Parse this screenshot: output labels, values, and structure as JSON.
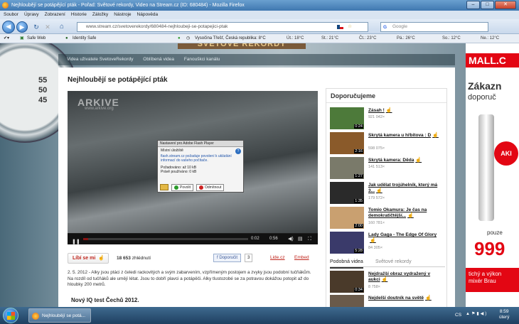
{
  "window": {
    "title": "Nejhloubějí se potápějící pták - Pořad: Světové rekordy, Video na Stream.cz (ID: 680484) - Mozilla Firefox"
  },
  "menu": [
    "Soubor",
    "Úpravy",
    "Zobrazení",
    "Historie",
    "Záložky",
    "Nástroje",
    "Nápověda"
  ],
  "nav": {
    "url": "www.stream.cz/svetoverekordy/680484-nejhloubeji-se-potapejici-ptak",
    "search_placeholder": "Google"
  },
  "toolbar": {
    "safeweb": "Safe Web",
    "identity": "Identity Safe",
    "location": "Vysočina Třešť, Česká republika: 8°C",
    "weather": [
      "Út.: 18°C",
      "St.: 21°C",
      "Čt.: 23°C",
      "Pá.: 26°C",
      "So.: 12°C",
      "Ne.: 12°C"
    ]
  },
  "site": {
    "nav": [
      "Videa uživatele SvetoveRekordy",
      "Oblíbená videa",
      "Fanouškci kanálu"
    ],
    "page_title": "Nejhloubějí se potápějící pták",
    "logo_text": "SVĚTOVÉ REKORDY"
  },
  "player": {
    "watermark": "ARKIVE",
    "watermark_sub": "www.arkive.org",
    "time_current": "0:02",
    "time_total": "0:56",
    "progress": 0.03
  },
  "flash_dialog": {
    "title": "Nastavení pro Adobe Flash Player",
    "section": "Místní úložiště",
    "text1": "flash.stream.cz požaduje povolení k ukládání informací do vašeho počítače.",
    "requested": "Požadováno: až 10 kB",
    "used": "Právě používáno: 0 kB",
    "allow": "Povolit",
    "deny": "Odmítnout",
    "help": "?"
  },
  "actions": {
    "like": "Líbí se mi",
    "views_count": "18 653",
    "views_label": "zhlédnutí",
    "fb": "Doporučit",
    "fb_count": "3",
    "lidecz": "Lide.cz",
    "embed": "Embed"
  },
  "description": "2. 5. 2012 - Alky jsou ptáci z čeledi rackovitých a svým zabarvením, vzpřímeným postojem a zvyky jsou podobní tučňákům. Na rozdíl od tučňáků ale umějí létat. Jsou to dobří plavci a potápěči. Alky tlustozobé se za potravou dokážou potopit až do hloubky 200 metrů.",
  "next_section": "Nový IQ test Čechů 2012.",
  "sidebar": {
    "header": "Doporučujeme",
    "items": [
      {
        "title": "Zásah !",
        "views": "921 042×",
        "dur": "0:24",
        "color": "#4d7a3a"
      },
      {
        "title": "Skrytá kamera u hřbitova : D",
        "views": "598 075×",
        "dur": "2:16",
        "color": "#8a5a2a"
      },
      {
        "title": "Skrytá kamera: Děda",
        "views": "141 513×",
        "dur": "1:27",
        "color": "#7a7a6a"
      },
      {
        "title": "Jak udělat trojúhelník, který má 3...",
        "views": "179 572×",
        "dur": "1:35",
        "color": "#2a2a2a"
      },
      {
        "title": "Tomio Okamura: Je čas na demokratičtější...",
        "views": "160 781×",
        "dur": "2:00",
        "color": "#c9a070"
      },
      {
        "title": "Lady Gaga - The Edge Of Glory",
        "views": "84 305×",
        "dur": "5:28",
        "color": "#3a3a6a"
      }
    ],
    "tab1": "Podobná videa",
    "tab2": "Světové rekordy",
    "similar": [
      {
        "title": "Nejdražší obraz vydražený v aukci",
        "views": "8 758×",
        "dur": "0:34",
        "color": "#4a3a2a"
      },
      {
        "title": "Nejdelší doutník na světě",
        "views": "",
        "dur": "",
        "color": "#6a5a4a"
      }
    ]
  },
  "ad": {
    "logo": "MALL.C",
    "line1": "Zákazn",
    "line2": "doporuč",
    "badge": "AKI",
    "line3": "pouze",
    "price": "999",
    "line4": "tichý a výkon",
    "line5": "mixér Brau"
  },
  "taskbar": {
    "task": "Nejhloubějí se potá...",
    "lang": "CS",
    "time": "8:59",
    "day": "úterý"
  },
  "colors": {
    "accent": "#c0261d",
    "mall": "#e30613"
  }
}
